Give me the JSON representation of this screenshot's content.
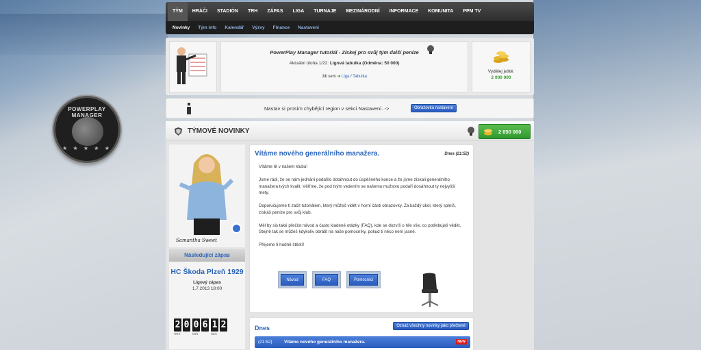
{
  "nav": {
    "top": [
      "TÝM",
      "HRÁČI",
      "STADIÓN",
      "TRH",
      "ZÁPAS",
      "LIGA",
      "TURNAJE",
      "MEZINÁRODNÍ",
      "INFORMACE",
      "KOMUNITA",
      "PPM TV"
    ],
    "sub": [
      "Novinky",
      "Tým info",
      "Kalendář",
      "Výzvy",
      "Finance",
      "Nastavení"
    ]
  },
  "logo": {
    "text": "POWERPLAY MANAGER"
  },
  "tutorial": {
    "title": "PowerPlay Manager tutoriál - Získej pro svůj tým další peníze",
    "task_prefix": "Aktuální úloha 1/22: ",
    "task": "Ligová tabulka (Odměna: 50 000)",
    "goto_prefix": "Jdi sem",
    "goto_link1": "Liga",
    "goto_sep": " / ",
    "goto_link2": "Tabulka",
    "remain_label": "Vydělej ještě:",
    "remain_value": "2 000 000"
  },
  "notice": {
    "text": "Nastav si prosím chybějící region v sekci Nastavení. ->",
    "button": "Obrazovka nastavení"
  },
  "panel": {
    "title": "TÝMOVÉ NOVINKY",
    "money": "2 050 000"
  },
  "manager": {
    "signature": "Samantha Sweet"
  },
  "next_match": {
    "header": "Následující zápas",
    "team": "HC Škoda Plzeň 1929",
    "type": "Ligový zápas",
    "date": "1.7.2013 18:00",
    "countdown": {
      "hrs": [
        "2",
        "0"
      ],
      "min": [
        "0",
        "6"
      ],
      "sec": [
        "1",
        "2"
      ],
      "hrs_label": "HRS",
      "min_label": "MIN",
      "sec_label": "SEC"
    }
  },
  "news": {
    "title": "Vítáme nového generálního manažera.",
    "date": "Dnes (21:52)",
    "paragraphs": [
      "Vítáme tě v našem klubu!",
      "Jsme rádi, že se nám jednání podařilo dotáhnout do úspěšného konce a že jsme získali generálního manažera tvých kvalit. Věříme, že pod tvým vedením se našemu mužstvu podaří dosáhnout ty nejvyšší mety.",
      "Doporučujeme ti začít tutoriálem, který můžeš vidět v horní části obrazovky. Za každý úkol, který splníš, získáš peníze pro svůj klub.",
      "Měl by sis také přečíst návod a často kladené otázky (FAQ), kde se dozvíš o hře vše, co potřebuješ vědět. Stejně tak se můžeš kdykoliv obrátit na naše pomocníky, pokud ti něco není jasné.",
      "Přejeme ti hodně štěstí!"
    ],
    "buttons": [
      "Návod",
      "FAQ",
      "Pomocníci"
    ]
  },
  "today": {
    "title": "Dnes",
    "mark_read": "Označ všechny novinky jako přečtené",
    "row_time": "(21:52)",
    "row_title": "Vítáme nového generálního manažera.",
    "badge": "NEW"
  },
  "colors": {
    "accent_blue": "#2c65b8",
    "money_green": "#2f9a2f",
    "new_red": "#d81d1d",
    "nav_dark": "#2e2e2e"
  }
}
